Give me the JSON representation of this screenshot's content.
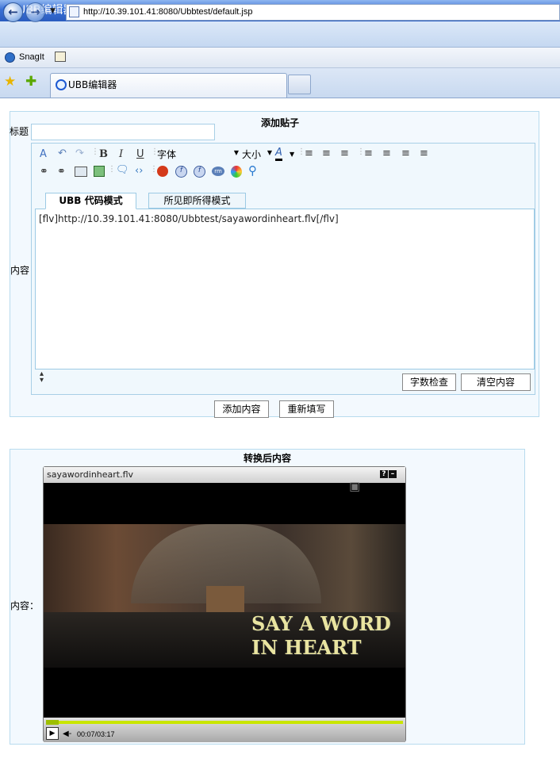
{
  "window": {
    "title": "UBB编辑器 - Windows Internet Explorer"
  },
  "address": {
    "url": "http://10.39.101.41:8080/Ubbtest/default.jsp"
  },
  "linkbar": {
    "snagit": "SnagIt"
  },
  "tabs": {
    "active_label": "UBB编辑器"
  },
  "form": {
    "heading": "添加贴子",
    "title_label": "标题",
    "title_value": "",
    "content_label": "内容",
    "toolbar": {
      "font_select": "字体",
      "size_select": "大小"
    },
    "mode_tabs": [
      "UBB 代码模式",
      "所见即所得模式"
    ],
    "editor_text": "[flv]http://10.39.101.41:8080/Ubbtest/sayawordinheart.flv[/flv]",
    "word_check_button": "字数检查",
    "clear_button": "清空内容",
    "add_button": "添加内容",
    "reset_button": "重新填写"
  },
  "result": {
    "heading": "转换后内容",
    "content_label": "内容：",
    "player": {
      "filename": "sayawordinheart.flv",
      "caption": "SAY A WORD\nIN HEART",
      "time": "00:07/03:17",
      "progress": 0.036
    }
  },
  "colors": {
    "panel_bg": "#f3f9fe",
    "panel_border": "#b8dbee",
    "progress": "#c9e600"
  }
}
